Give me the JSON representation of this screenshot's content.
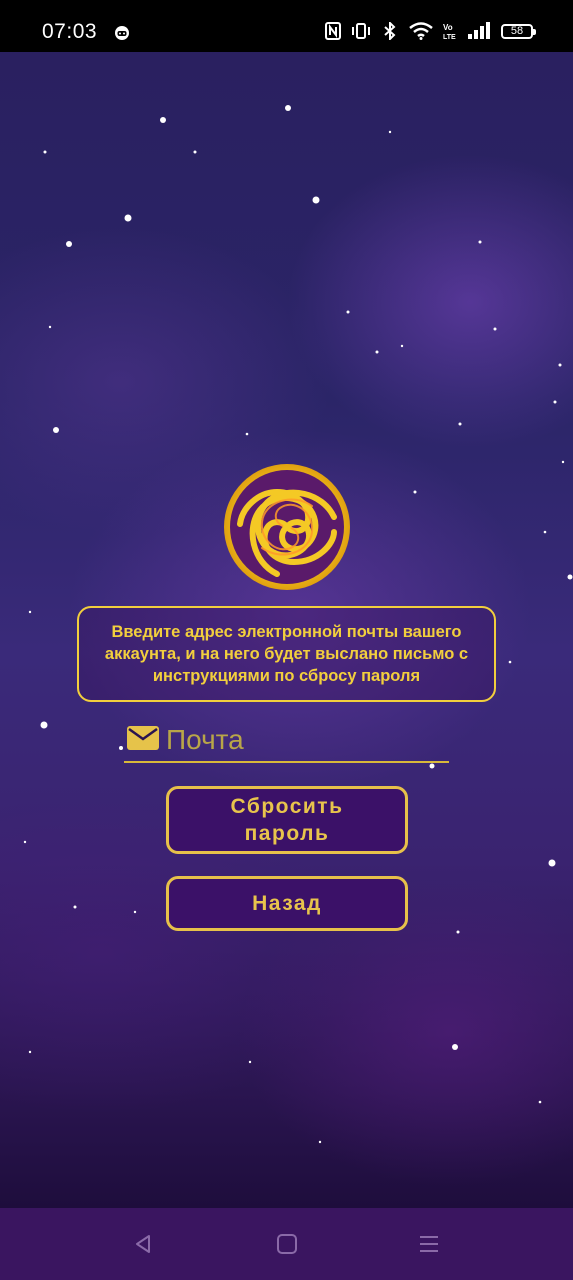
{
  "status_bar": {
    "time": "07:03",
    "battery": "58"
  },
  "screen": {
    "instructions": "Введите адрес электронной почты вашего аккаунта, и на него будет выслано письмо с инструкциями по сбросу пароля",
    "email_placeholder": "Почта",
    "reset_button": "Сбросить\nпароль",
    "back_button": "Назад"
  },
  "icons": {
    "logo": "golden-spiral-logo",
    "email": "envelope-icon"
  },
  "colors": {
    "accent_gold": "#f2cf3d",
    "button_fill": "#3b1168",
    "nav_bar": "#3a1560"
  }
}
